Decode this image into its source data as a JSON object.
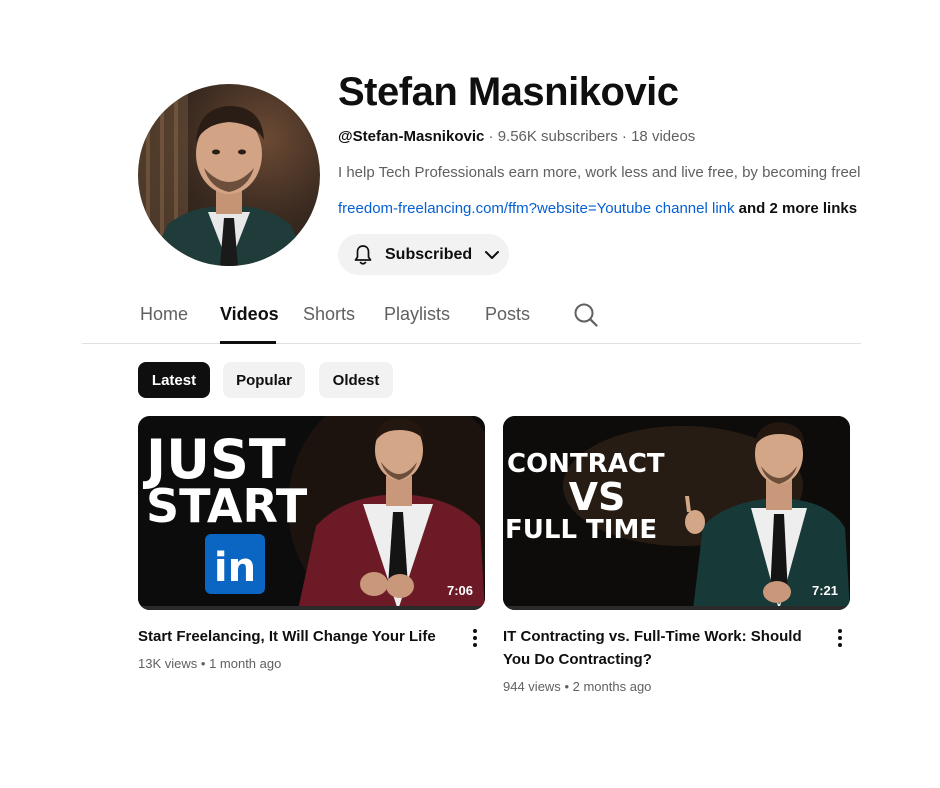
{
  "channel": {
    "name": "Stefan Masnikovic",
    "handle": "@Stefan-Masnikovic",
    "subscribers": "9.56K subscribers",
    "videos_count": "18 videos",
    "separator": "·",
    "description": "I help Tech Professionals earn more, work less and live free, by becoming freelancers",
    "link": "freedom-freelancing.com/ffm?website=Youtube channel link",
    "more_links": "and 2 more links"
  },
  "subscribe_button": {
    "label": "Subscribed"
  },
  "tabs": [
    {
      "label": "Home"
    },
    {
      "label": "Videos"
    },
    {
      "label": "Shorts"
    },
    {
      "label": "Playlists"
    },
    {
      "label": "Posts"
    }
  ],
  "filters": [
    {
      "label": "Latest"
    },
    {
      "label": "Popular"
    },
    {
      "label": "Oldest"
    }
  ],
  "videos": [
    {
      "title": "Start Freelancing, It Will Change Your Life",
      "views": "13K views",
      "age": "1 month ago",
      "duration": "7:06",
      "thumb_line1": "JUST",
      "thumb_line2": "START",
      "thumb_badge": "in"
    },
    {
      "title": "IT Contracting vs. Full-Time Work: Should You Do Contracting?",
      "views": "944 views",
      "age": "2 months ago",
      "duration": "7:21",
      "thumb_line1": "CONTRACT",
      "thumb_line2": "VS",
      "thumb_line3": "FULL TIME"
    }
  ],
  "meta_dot": "•",
  "colors": {
    "link": "#065fd4",
    "linkedin": "#0a66c2",
    "chip_active": "#0f0f0f"
  }
}
